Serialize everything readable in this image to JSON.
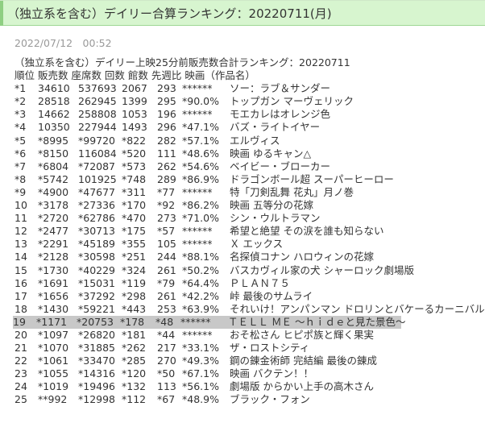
{
  "header": {
    "title": "（独立系を含む）デイリー合算ランキング：20220711(月)",
    "accent_color": "#d7f5cf"
  },
  "post": {
    "date": "2022/07/12　00:52"
  },
  "article": {
    "subtitle": "（独立系を含む）デイリー上映25分前販売数合計ランキング：20220711",
    "columns": "順位 販売数 座席数 回数 館数 先週比 映画（作品名）",
    "rows": [
      [
        "*1",
        "34610",
        "537693",
        "2067",
        "293",
        "******",
        "ソー：ラブ＆サンダー"
      ],
      [
        "*2",
        "28518",
        "262945",
        "1399",
        "295",
        "*90.0%",
        "トップガン マーヴェリック"
      ],
      [
        "*3",
        "14662",
        "258808",
        "1053",
        "196",
        "******",
        "モエカレはオレンジ色"
      ],
      [
        "*4",
        "10350",
        "227944",
        "1493",
        "296",
        "*47.1%",
        "バズ・ライトイヤー"
      ],
      [
        "*5",
        "*8995",
        "*99720",
        "*822",
        "282",
        "*57.1%",
        "エルヴィス"
      ],
      [
        "*6",
        "*8150",
        "116084",
        "*520",
        "111",
        "*48.6%",
        "映画 ゆるキャン△"
      ],
      [
        "*7",
        "*6804",
        "*72087",
        "*573",
        "262",
        "*54.6%",
        "ベイビー・ブローカー"
      ],
      [
        "*8",
        "*5742",
        "101925",
        "*748",
        "289",
        "*86.9%",
        "ドラゴンボール超 スーパーヒーロー"
      ],
      [
        "*9",
        "*4900",
        "*47677",
        "*311",
        "*77",
        "******",
        "特「刀剣乱舞 花丸」月ノ巻"
      ],
      [
        "10",
        "*3178",
        "*27336",
        "*170",
        "*92",
        "*86.2%",
        "映画 五等分の花嫁"
      ],
      [
        "11",
        "*2720",
        "*62786",
        "*470",
        "273",
        "*71.0%",
        "シン・ウルトラマン"
      ],
      [
        "12",
        "*2477",
        "*30713",
        "*175",
        "*57",
        "******",
        "希望と絶望 その涙を誰も知らない"
      ],
      [
        "13",
        "*2291",
        "*45189",
        "*355",
        "105",
        "******",
        "Ｘ エックス"
      ],
      [
        "14",
        "*2128",
        "*30598",
        "*251",
        "244",
        "*88.1%",
        "名探偵コナン ハロウィンの花嫁"
      ],
      [
        "15",
        "*1730",
        "*40229",
        "*324",
        "261",
        "*50.2%",
        "バスカヴィル家の犬 シャーロック劇場版"
      ],
      [
        "16",
        "*1691",
        "*15031",
        "*119",
        "*79",
        "*64.4%",
        "ＰＬＡＮ７５"
      ],
      [
        "17",
        "*1656",
        "*37292",
        "*298",
        "261",
        "*42.2%",
        "峠 最後のサムライ"
      ],
      [
        "18",
        "*1430",
        "*59221",
        "*443",
        "253",
        "*63.9%",
        "それいけ！アンパンマン ドロリンとバケーるカーニバル"
      ],
      [
        "19",
        "*1171",
        "*20753",
        "*178",
        "*48",
        "******",
        "ＴＥＬＬ ＭＥ 〜ｈｉｄｅと見た景色〜"
      ],
      [
        "20",
        "*1097",
        "*26820",
        "*181",
        "*44",
        "******",
        "おそ松さん ヒピポ族と輝く果実"
      ],
      [
        "21",
        "*1070",
        "*31885",
        "*262",
        "217",
        "*33.1%",
        "ザ・ロストシティ"
      ],
      [
        "22",
        "*1061",
        "*33470",
        "*285",
        "270",
        "*49.3%",
        "鋼の錬金術師 完結編 最後の錬成"
      ],
      [
        "23",
        "*1055",
        "*14316",
        "*120",
        "*50",
        "*67.1%",
        "映画 バクテン！！"
      ],
      [
        "24",
        "*1019",
        "*19496",
        "*132",
        "113",
        "*56.1%",
        "劇場版 からかい上手の高木さん"
      ],
      [
        "25",
        "**992",
        "*12998",
        "*112",
        "*67",
        "*48.9%",
        "ブラック・フォン"
      ]
    ],
    "highlight_rank": "19",
    "highlight_color": "#c8c8c8"
  }
}
